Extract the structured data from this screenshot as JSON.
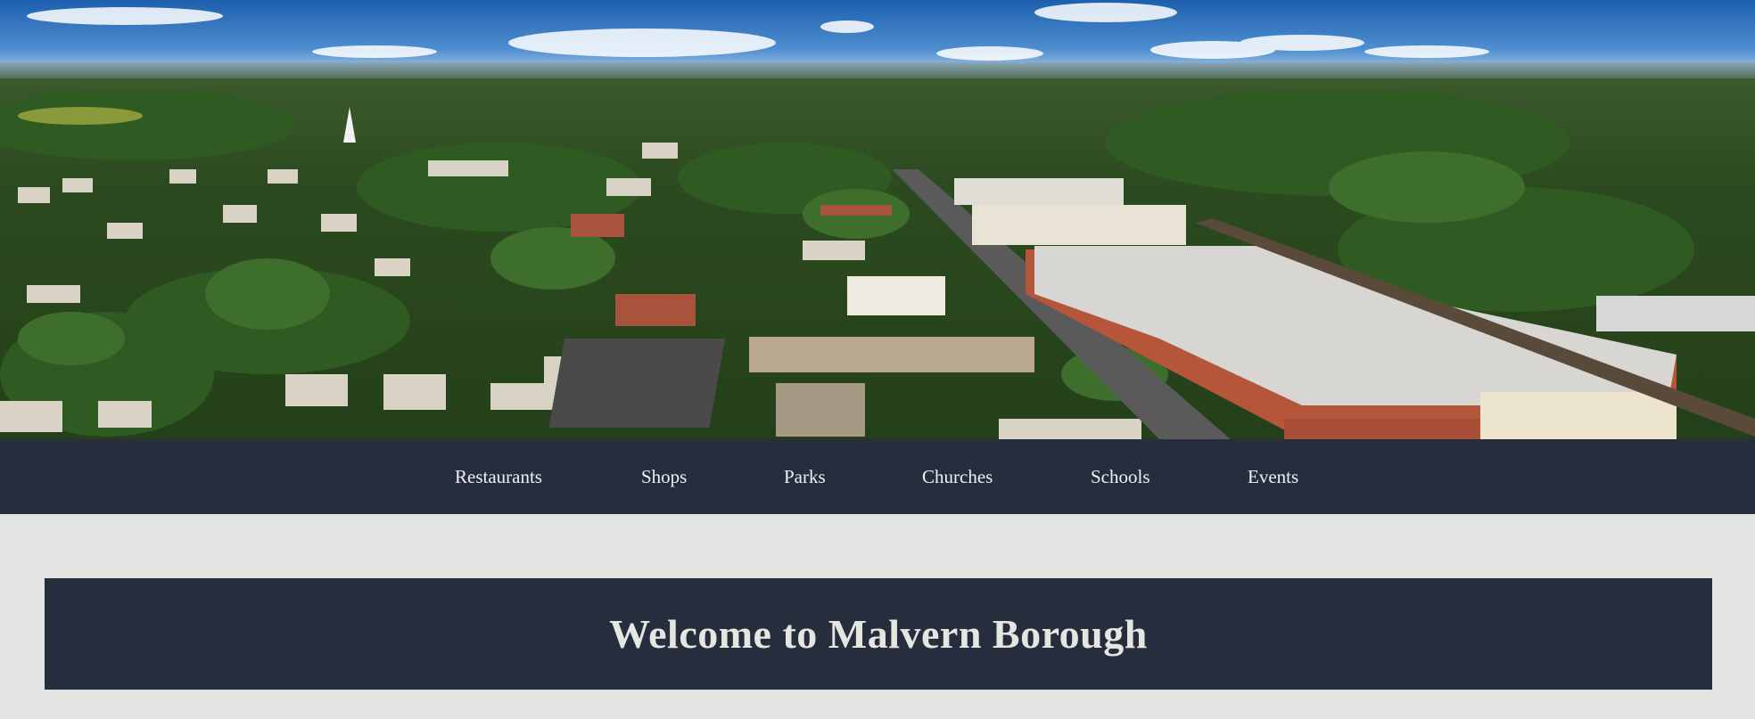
{
  "hero": {
    "image_subject": "aerial-town-photo"
  },
  "nav": {
    "items": [
      {
        "label": "Restaurants"
      },
      {
        "label": "Shops"
      },
      {
        "label": "Parks"
      },
      {
        "label": "Churches"
      },
      {
        "label": "Schools"
      },
      {
        "label": "Events"
      }
    ]
  },
  "welcome": {
    "heading": "Welcome to Malvern Borough"
  },
  "colors": {
    "page_background": "#e2e4e1",
    "nav_background": "#262e3d",
    "banner_background": "#262e3d",
    "nav_text": "#eef0f2",
    "heading_text": "#e6e6e1"
  }
}
